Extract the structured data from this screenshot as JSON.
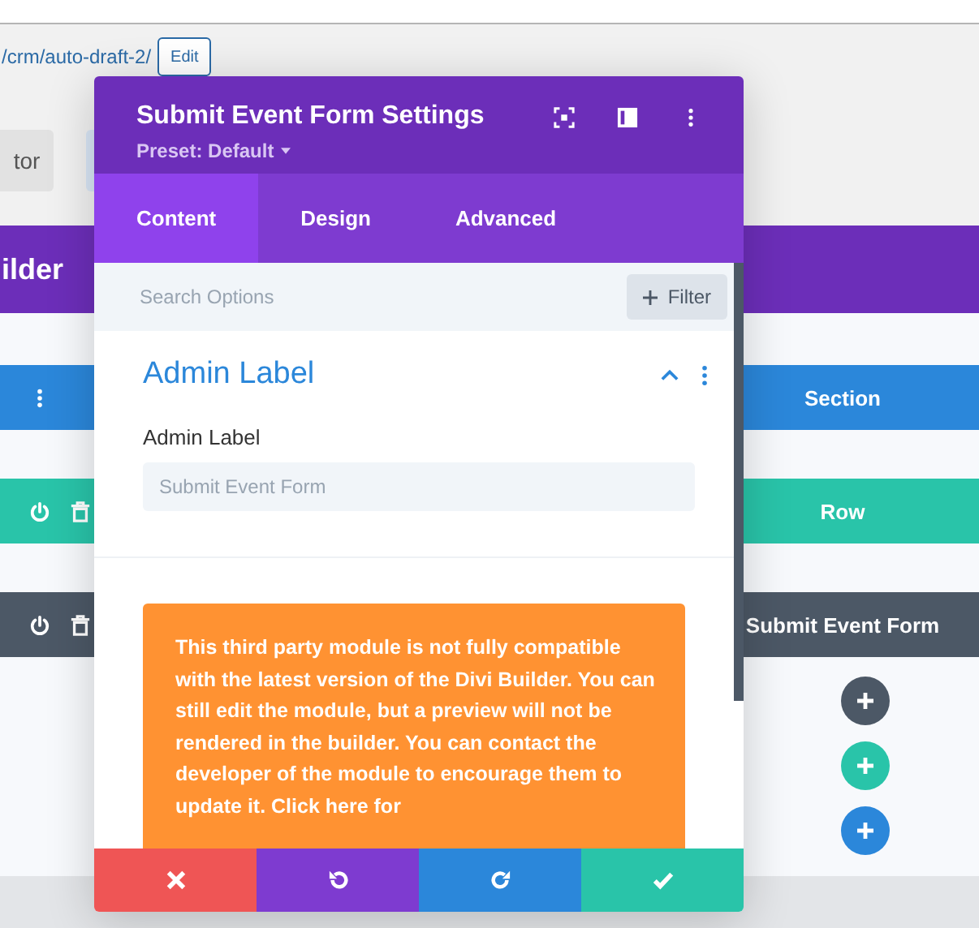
{
  "address": {
    "path": "/crm/auto-draft-2/",
    "edit_button": "Edit"
  },
  "toolbar": {
    "button": "tor"
  },
  "builder_bar": {
    "title": "ilder"
  },
  "layers": [
    {
      "kind": "section",
      "label": "Section"
    },
    {
      "kind": "row",
      "label": "Row"
    },
    {
      "kind": "module",
      "label": "Submit Event Form"
    }
  ],
  "add_buttons": [
    {
      "kind": "module"
    },
    {
      "kind": "row"
    },
    {
      "kind": "section"
    }
  ],
  "modal": {
    "title": "Submit Event Form Settings",
    "preset": "Preset: Default",
    "tabs": [
      {
        "label": "Content",
        "selected": true
      },
      {
        "label": "Design",
        "selected": false
      },
      {
        "label": "Advanced",
        "selected": false
      }
    ],
    "search": {
      "placeholder": "Search Options"
    },
    "filter_button": "Filter",
    "group": {
      "title": "Admin Label",
      "expanded": true,
      "field_label": "Admin Label",
      "field": {
        "placeholder": "Submit Event Form"
      }
    },
    "notice": "This third party module is not fully compatible with the latest version of the Divi Builder. You can still edit the module, but a preview will not be rendered in the builder. You can contact the developer of the module to encourage them to update it. **Click here** for",
    "footer": [
      {
        "kind": "discard"
      },
      {
        "kind": "undo"
      },
      {
        "kind": "redo"
      },
      {
        "kind": "save"
      }
    ]
  }
}
